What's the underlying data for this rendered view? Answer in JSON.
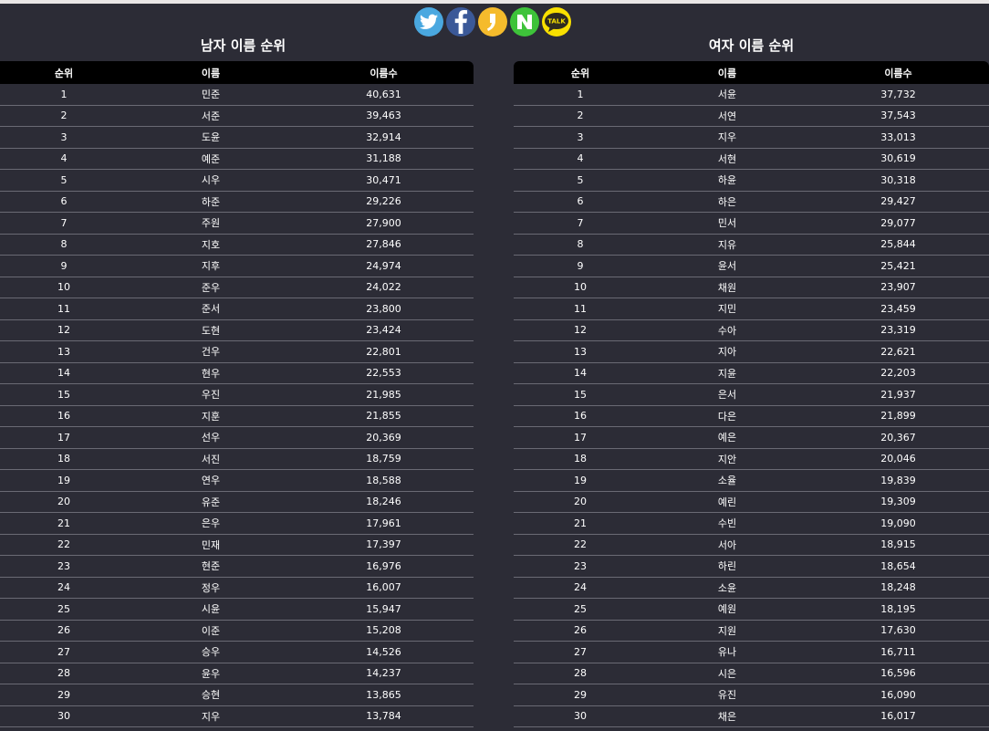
{
  "share": [
    {
      "name": "twitter",
      "icon": "twitter-icon",
      "color": "#4aa8e0"
    },
    {
      "name": "facebook",
      "icon": "facebook-icon",
      "color": "#3b5998"
    },
    {
      "name": "kakaostory",
      "icon": "kakaostory-icon",
      "color": "#f5bb2c"
    },
    {
      "name": "naver",
      "icon": "naver-icon",
      "color": "#3ec33a"
    },
    {
      "name": "kakaotalk",
      "icon": "kakaotalk-icon",
      "label": "TALK",
      "color": "#f9e000"
    }
  ],
  "male": {
    "title": "남자 이름 순위",
    "headers": [
      "순위",
      "이름",
      "이름수"
    ],
    "rows": [
      [
        "1",
        "민준",
        "40,631"
      ],
      [
        "2",
        "서준",
        "39,463"
      ],
      [
        "3",
        "도윤",
        "32,914"
      ],
      [
        "4",
        "예준",
        "31,188"
      ],
      [
        "5",
        "시우",
        "30,471"
      ],
      [
        "6",
        "하준",
        "29,226"
      ],
      [
        "7",
        "주원",
        "27,900"
      ],
      [
        "8",
        "지호",
        "27,846"
      ],
      [
        "9",
        "지후",
        "24,974"
      ],
      [
        "10",
        "준우",
        "24,022"
      ],
      [
        "11",
        "준서",
        "23,800"
      ],
      [
        "12",
        "도현",
        "23,424"
      ],
      [
        "13",
        "건우",
        "22,801"
      ],
      [
        "14",
        "현우",
        "22,553"
      ],
      [
        "15",
        "우진",
        "21,985"
      ],
      [
        "16",
        "지훈",
        "21,855"
      ],
      [
        "17",
        "선우",
        "20,369"
      ],
      [
        "18",
        "서진",
        "18,759"
      ],
      [
        "19",
        "연우",
        "18,588"
      ],
      [
        "20",
        "유준",
        "18,246"
      ],
      [
        "21",
        "은우",
        "17,961"
      ],
      [
        "22",
        "민재",
        "17,397"
      ],
      [
        "23",
        "현준",
        "16,976"
      ],
      [
        "24",
        "정우",
        "16,007"
      ],
      [
        "25",
        "시윤",
        "15,947"
      ],
      [
        "26",
        "이준",
        "15,208"
      ],
      [
        "27",
        "승우",
        "14,526"
      ],
      [
        "28",
        "윤우",
        "14,237"
      ],
      [
        "29",
        "승현",
        "13,865"
      ],
      [
        "30",
        "지우",
        "13,784"
      ]
    ]
  },
  "female": {
    "title": "여자 이름 순위",
    "headers": [
      "순위",
      "이름",
      "이름수"
    ],
    "rows": [
      [
        "1",
        "서윤",
        "37,732"
      ],
      [
        "2",
        "서연",
        "37,543"
      ],
      [
        "3",
        "지우",
        "33,013"
      ],
      [
        "4",
        "서현",
        "30,619"
      ],
      [
        "5",
        "하윤",
        "30,318"
      ],
      [
        "6",
        "하은",
        "29,427"
      ],
      [
        "7",
        "민서",
        "29,077"
      ],
      [
        "8",
        "지유",
        "25,844"
      ],
      [
        "9",
        "윤서",
        "25,421"
      ],
      [
        "10",
        "채원",
        "23,907"
      ],
      [
        "11",
        "지민",
        "23,459"
      ],
      [
        "12",
        "수아",
        "23,319"
      ],
      [
        "13",
        "지아",
        "22,621"
      ],
      [
        "14",
        "지윤",
        "22,203"
      ],
      [
        "15",
        "은서",
        "21,937"
      ],
      [
        "16",
        "다은",
        "21,899"
      ],
      [
        "17",
        "예은",
        "20,367"
      ],
      [
        "18",
        "지안",
        "20,046"
      ],
      [
        "19",
        "소율",
        "19,839"
      ],
      [
        "20",
        "예린",
        "19,309"
      ],
      [
        "21",
        "수빈",
        "19,090"
      ],
      [
        "22",
        "서아",
        "18,915"
      ],
      [
        "23",
        "하린",
        "18,654"
      ],
      [
        "24",
        "소윤",
        "18,248"
      ],
      [
        "25",
        "예원",
        "18,195"
      ],
      [
        "26",
        "지원",
        "17,630"
      ],
      [
        "27",
        "유나",
        "16,711"
      ],
      [
        "28",
        "시은",
        "16,596"
      ],
      [
        "29",
        "유진",
        "16,090"
      ],
      [
        "30",
        "채은",
        "16,017"
      ]
    ]
  }
}
